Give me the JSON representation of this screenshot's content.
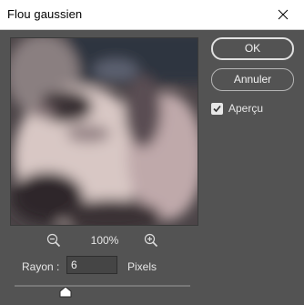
{
  "window": {
    "title": "Flou gaussien"
  },
  "zoom": {
    "level": "100%"
  },
  "radius": {
    "label": "Rayon :",
    "value": "6",
    "unit": "Pixels",
    "slider_fraction": 0.3
  },
  "buttons": {
    "ok": "OK",
    "cancel": "Annuler"
  },
  "preview_toggle": {
    "label": "Aperçu",
    "checked": true
  },
  "colors": {
    "background": "#535353",
    "titlebar": "#ffffff",
    "control_border": "#b5b5b5"
  }
}
